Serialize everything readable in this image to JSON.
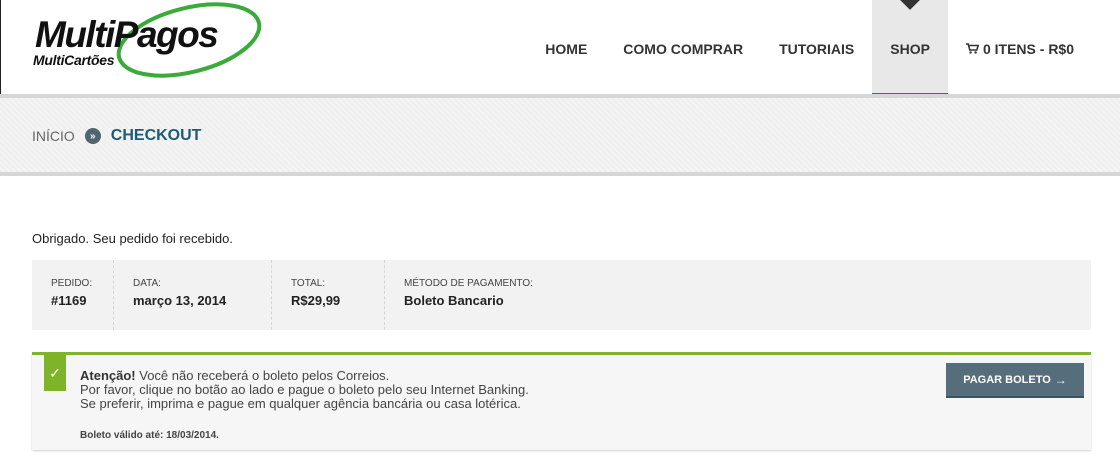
{
  "brand": {
    "name": "MultiPagos",
    "tagline": "MultiCartões",
    "accent_green": "#3aaa3a"
  },
  "nav": {
    "items": [
      {
        "label": "HOME"
      },
      {
        "label": "COMO COMPRAR"
      },
      {
        "label": "TUTORIAIS"
      },
      {
        "label": "SHOP",
        "active": true
      }
    ],
    "cart": {
      "icon": "cart-icon",
      "label": "0 ITENS - R$0"
    }
  },
  "breadcrumb": {
    "home": "INÍCIO",
    "separator": "»",
    "current": "CHECKOUT"
  },
  "thanks_message": "Obrigado. Seu pedido foi recebido.",
  "order": {
    "number_label": "PEDIDO:",
    "number": "#1169",
    "date_label": "DATA:",
    "date": "março 13, 2014",
    "total_label": "TOTAL:",
    "total": "R$29,99",
    "method_label": "MÉTODO DE PAGAMENTO:",
    "method": "Boleto Bancario"
  },
  "notice": {
    "check": "✓",
    "title": "Atenção!",
    "line1": "Você não receberá o boleto pelos Correios.",
    "line2": "Por favor, clique no botão ao lado e pague o boleto pelo seu Internet Banking.",
    "line3": "Se preferir, imprima e pague em qualquer agência bancária ou casa lotérica.",
    "validity": "Boleto válido até: 18/03/2014.",
    "button": "PAGAR BOLETO",
    "button_arrow": "→",
    "accent": "#7fb32a",
    "button_color": "#566e7b"
  }
}
